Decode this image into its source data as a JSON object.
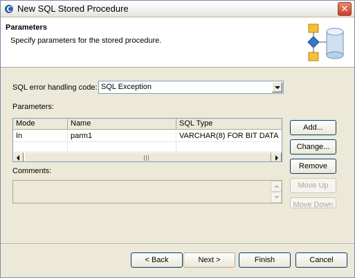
{
  "window": {
    "title": "New SQL Stored Procedure",
    "close_glyph": "✕"
  },
  "header": {
    "title": "Parameters",
    "description": "Specify parameters for the stored procedure.",
    "art_icon": "wizard-database-icon"
  },
  "error_handling": {
    "label": "SQL error handling code:",
    "value": "SQL Exception"
  },
  "parameters": {
    "label": "Parameters:",
    "columns": [
      "Mode",
      "Name",
      "SQL Type"
    ],
    "rows": [
      {
        "mode": "In",
        "name": "parm1",
        "sql_type": "VARCHAR(8) FOR BIT DATA"
      }
    ]
  },
  "side_buttons": {
    "add": "Add...",
    "change": "Change...",
    "remove": "Remove",
    "move_up": "Move Up",
    "move_down": "Move Down"
  },
  "comments": {
    "label": "Comments:",
    "value": ""
  },
  "footer": {
    "back": "< Back",
    "next": "Next >",
    "finish": "Finish",
    "cancel": "Cancel"
  },
  "colors": {
    "accent": "#003c74",
    "title_bg": "#f1f1ee",
    "dialog_bg": "#ece9d8",
    "close_red": "#c4432a"
  }
}
